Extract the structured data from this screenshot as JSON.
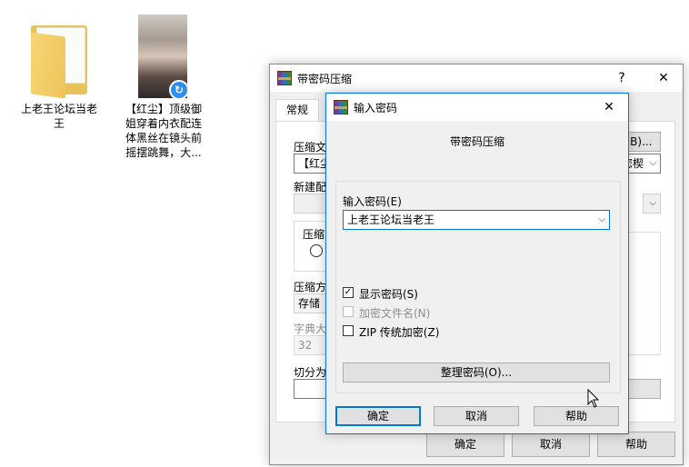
{
  "desktop": {
    "folder_label": "上老王论坛当老王",
    "video_label": "【红尘】顶级御姐穿着内衣配连体黑丝在镜头前摇摆跳舞，大..."
  },
  "back_dialog": {
    "title": "带密码压缩",
    "help_btn": "?",
    "close_btn": "✕",
    "tab_general": "常规",
    "archive_name_label": "压缩文",
    "browse_button": "(B)...",
    "archive_name_value": "【红尘",
    "profile_value": "您楔",
    "new_profile_label": "新建配",
    "format_label": "压缩",
    "method_label": "压缩方",
    "method_value": "存储",
    "dict_label": "字典大",
    "dict_value": "32",
    "split_label": "切分为",
    "ok": "确定",
    "cancel": "取消",
    "help": "帮助"
  },
  "front_dialog": {
    "title": "输入密码",
    "close_btn": "✕",
    "heading": "带密码压缩",
    "password_label": "输入密码(E)",
    "password_value": "上老王论坛当老王",
    "show_password": "显示密码(S)",
    "show_password_checked": true,
    "encrypt_filenames": "加密文件名(N)",
    "encrypt_filenames_checked": false,
    "zip_legacy": "ZIP 传统加密(Z)",
    "zip_legacy_checked": false,
    "organize_button": "整理密码(O)...",
    "ok": "确定",
    "cancel": "取消",
    "help": "帮助"
  }
}
